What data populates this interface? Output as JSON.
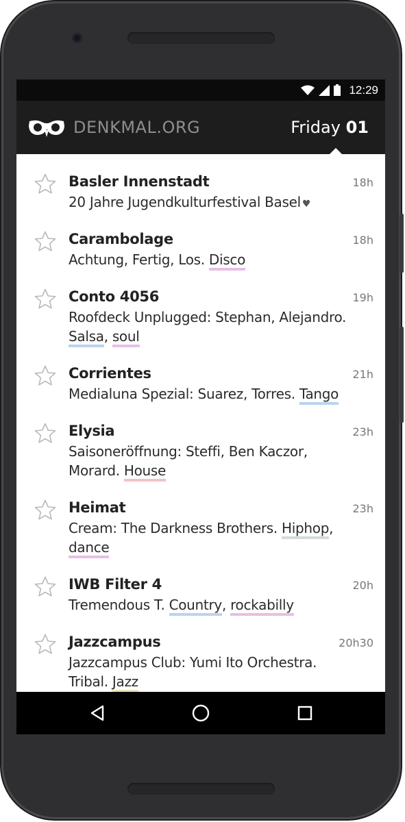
{
  "status_bar": {
    "time": "12:29"
  },
  "app": {
    "brand": "DENKMAL.ORG",
    "day": "Friday",
    "date_num": "01"
  },
  "colors": {
    "disco": "#e7bfe5",
    "salsa": "#bcd3ec",
    "soul": "#e7bfe5",
    "tango": "#bcd3ec",
    "house": "#f0c4c4",
    "hiphop": "#d3ddd5",
    "dance": "#e7bfe5",
    "country": "#bcd3ec",
    "rockabilly": "#e7bfe5",
    "jazz": "#ece2b8"
  },
  "events": [
    {
      "venue": "Basler Innenstadt",
      "desc": "20 Jahre Jugendkulturfestival Basel",
      "time": "18h",
      "icon": "heart-icon"
    },
    {
      "venue": "Carambolage",
      "desc": "Achtung, Fertig, Los.",
      "tags": [
        "Disco"
      ],
      "time": "18h"
    },
    {
      "venue": "Conto 4056",
      "desc": "Roofdeck Unplugged: Stephan, Alejandro.",
      "tags": [
        "Salsa",
        "soul"
      ],
      "time": "19h"
    },
    {
      "venue": "Corrientes",
      "desc": "Medialuna Spezial: Suarez, Torres.",
      "tags": [
        "Tango"
      ],
      "time": "21h"
    },
    {
      "venue": "Elysia",
      "desc": "Saisoneröffnung: Steffi, Ben Kaczor, Morard.",
      "tags": [
        "House"
      ],
      "time": "23h"
    },
    {
      "venue": "Heimat",
      "desc": "Cream: The Darkness Brothers.",
      "tags": [
        "Hiphop",
        "dance"
      ],
      "time": "23h"
    },
    {
      "venue": "IWB Filter 4",
      "desc": "Tremendous T.",
      "tags": [
        "Country",
        "rockabilly"
      ],
      "time": "20h"
    },
    {
      "venue": "Jazzcampus",
      "desc": "Jazzcampus Club: Yumi Ito Orchestra. Tribal.",
      "tags": [
        "Jazz"
      ],
      "time": "20h30"
    }
  ],
  "nav": {
    "back": "back-icon",
    "home": "home-icon",
    "recents": "recents-icon"
  }
}
